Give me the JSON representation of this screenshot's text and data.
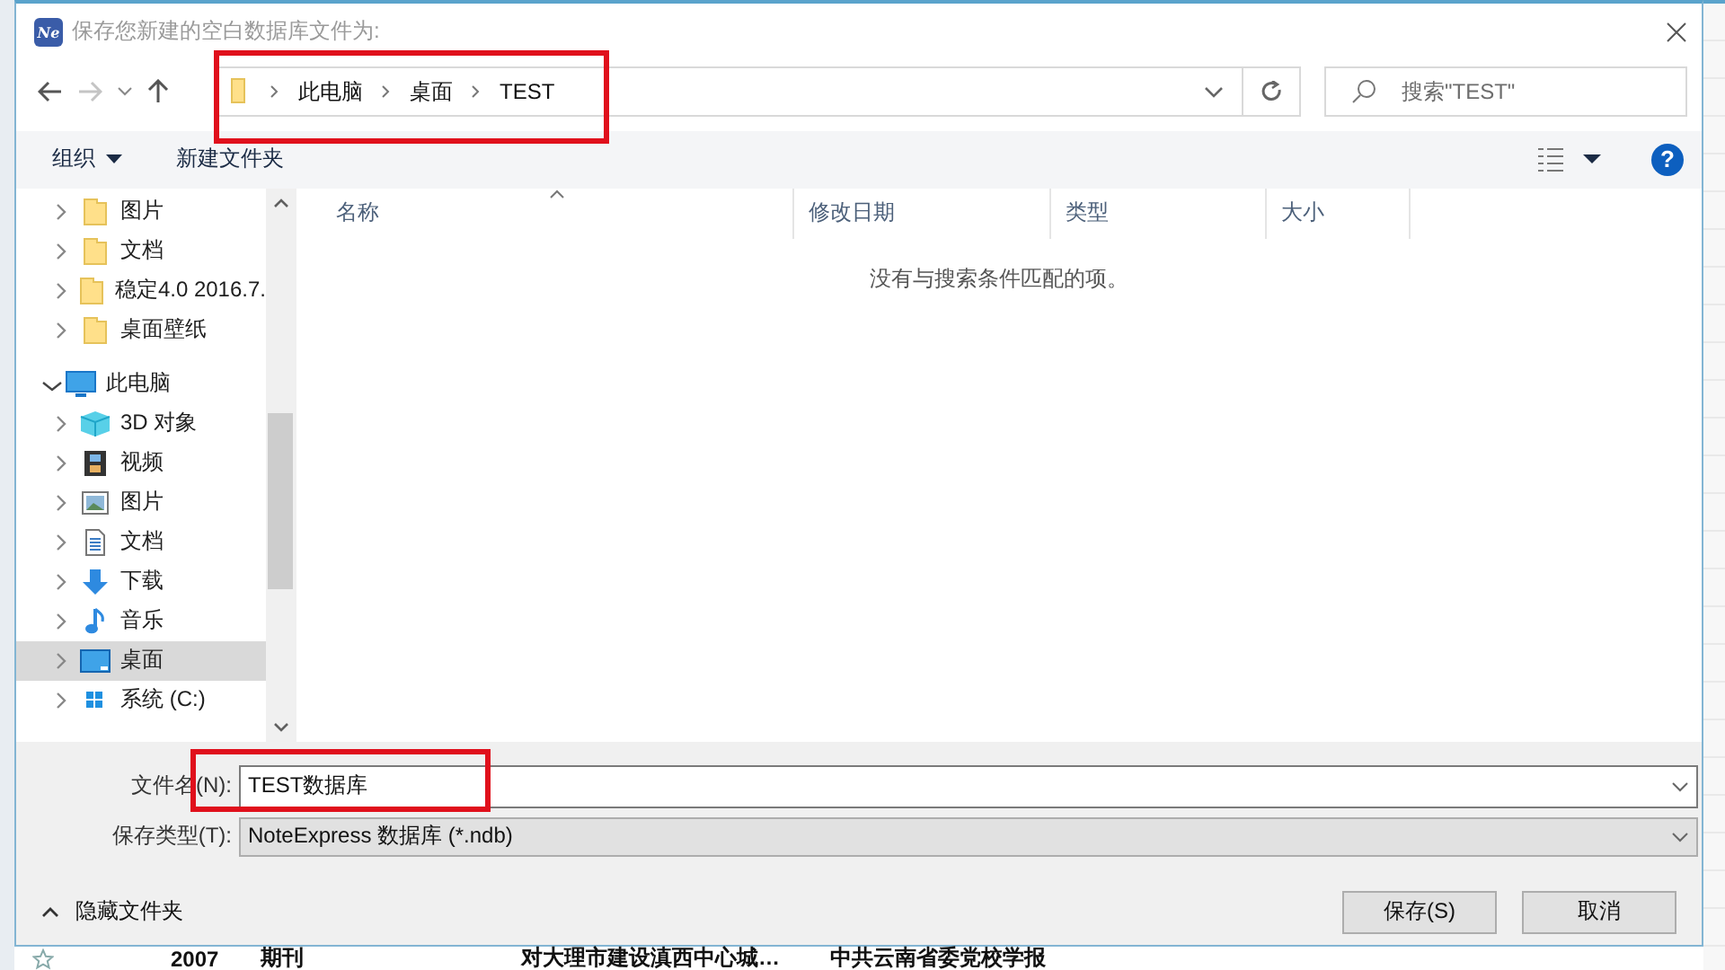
{
  "window": {
    "title": "保存您新建的空白数据库文件为:",
    "logo_text": "Ne"
  },
  "address_bar": {
    "path": [
      "此电脑",
      "桌面",
      "TEST"
    ],
    "highlighted": true
  },
  "search": {
    "placeholder": "搜索\"TEST\""
  },
  "toolbar": {
    "organize": "组织",
    "new_folder": "新建文件夹",
    "help": "?"
  },
  "nav_tree": {
    "items": [
      {
        "label": "图片",
        "kind": "folder",
        "expanded": false,
        "selected": false
      },
      {
        "label": "文档",
        "kind": "folder",
        "expanded": false,
        "selected": false
      },
      {
        "label": "稳定4.0 2016.7.",
        "kind": "folder",
        "expanded": false,
        "selected": false
      },
      {
        "label": "桌面壁纸",
        "kind": "folder",
        "expanded": false,
        "selected": false
      },
      {
        "label": "此电脑",
        "kind": "pc",
        "expanded": true,
        "selected": false,
        "children": [
          {
            "label": "3D 对象",
            "kind": "cube",
            "expanded": false,
            "selected": false
          },
          {
            "label": "视频",
            "kind": "video",
            "expanded": false,
            "selected": false
          },
          {
            "label": "图片",
            "kind": "picture",
            "expanded": false,
            "selected": false
          },
          {
            "label": "文档",
            "kind": "document",
            "expanded": false,
            "selected": false
          },
          {
            "label": "下载",
            "kind": "download",
            "expanded": false,
            "selected": false
          },
          {
            "label": "音乐",
            "kind": "music",
            "expanded": false,
            "selected": false
          },
          {
            "label": "桌面",
            "kind": "desktop",
            "expanded": false,
            "selected": true
          },
          {
            "label": "系统 (C:)",
            "kind": "drive",
            "expanded": false,
            "selected": false
          }
        ]
      }
    ]
  },
  "file_list": {
    "columns": [
      {
        "label": "名称",
        "sorted": true
      },
      {
        "label": "修改日期",
        "sorted": false
      },
      {
        "label": "类型",
        "sorted": false
      },
      {
        "label": "大小",
        "sorted": false
      }
    ],
    "empty_message": "没有与搜索条件匹配的项。"
  },
  "save_panel": {
    "file_name": {
      "label": "文件名(N):",
      "value": "TEST数据库",
      "highlighted": true
    },
    "file_type": {
      "label": "保存类型(T):",
      "value": "NoteExpress 数据库 (*.ndb)"
    },
    "hide_folders": "隐藏文件夹",
    "buttons": [
      {
        "label": "保存(S)"
      },
      {
        "label": "取消"
      }
    ]
  },
  "background_row": {
    "cells": [
      "2007",
      "期刊",
      "对大理市建设滇西中心城…",
      "中共云南省委党校学报"
    ]
  }
}
